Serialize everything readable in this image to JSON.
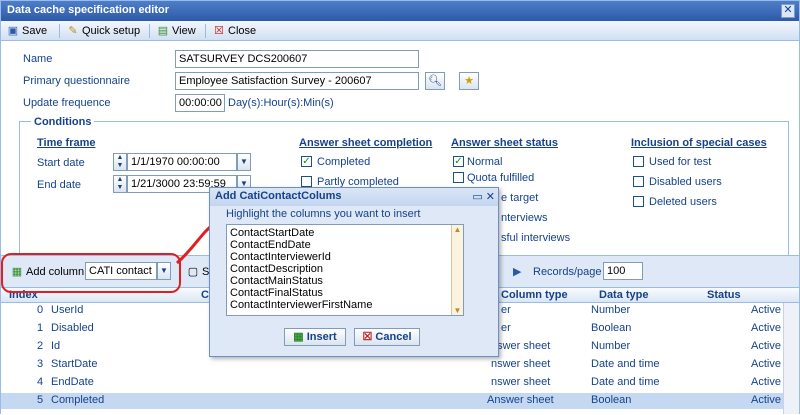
{
  "window": {
    "title": "Data cache specification editor"
  },
  "toolbar": {
    "save": "Save",
    "quick_setup": "Quick setup",
    "view": "View",
    "close": "Close"
  },
  "form": {
    "name_label": "Name",
    "name_value": "SATSURVEY DCS200607",
    "pq_label": "Primary questionnaire",
    "pq_value": "Employee Satisfaction Survey - 200607",
    "uf_label": "Update frequence",
    "uf_value": "00:00:00",
    "uf_unit": "Day(s):Hour(s):Min(s)"
  },
  "conditions": {
    "legend": "Conditions",
    "time_frame": "Time frame",
    "start_label": "Start date",
    "start_value": "1/1/1970 00:00:00",
    "end_label": "End date",
    "end_value": "1/21/3000 23:59:59",
    "asc_title": "Answer sheet completion",
    "asc": [
      "Completed",
      "Partly completed"
    ],
    "ass_title": "Answer sheet status",
    "ass": [
      "Normal",
      "Quota fulfilled",
      "e target",
      "nterviews",
      "sful interviews"
    ],
    "isc_title": "Inclusion of special cases",
    "isc": [
      "Used for test",
      "Disabled users",
      "Deleted users"
    ]
  },
  "gridbar": {
    "add_column": "Add column",
    "combo_value": "CATI contact",
    "s_fragment": "S",
    "records_label": "Records/page",
    "records_value": "100"
  },
  "grid": {
    "headers": {
      "index": "Index",
      "c": "C",
      "column_type": "Column type",
      "data_type": "Data type",
      "status": "Status"
    },
    "rows": [
      {
        "index": "0",
        "name": "UserId",
        "ctype": "er",
        "dtype": "Number",
        "status": "Active"
      },
      {
        "index": "1",
        "name": "Disabled",
        "ctype": "er",
        "dtype": "Boolean",
        "status": "Active"
      },
      {
        "index": "2",
        "name": "Id",
        "ctype": "nswer sheet",
        "dtype": "Number",
        "status": "Active"
      },
      {
        "index": "3",
        "name": "StartDate",
        "ctype": "nswer sheet",
        "dtype": "Date and time",
        "status": "Active"
      },
      {
        "index": "4",
        "name": "EndDate",
        "ctype": "nswer sheet",
        "dtype": "Date and time",
        "status": "Active"
      },
      {
        "index": "5",
        "name": "Completed",
        "ctype": "Answer sheet",
        "dtype": "Boolean",
        "status": "Active"
      }
    ]
  },
  "dialog": {
    "title": "Add CatiContactColums",
    "hint": "Highlight the columns you want to insert",
    "items": [
      "ContactStartDate",
      "ContactEndDate",
      "ContactInterviewerId",
      "ContactDescription",
      "ContactMainStatus",
      "ContactFinalStatus",
      "ContactInterviewerFirstName"
    ],
    "insert": "Insert",
    "cancel": "Cancel"
  }
}
